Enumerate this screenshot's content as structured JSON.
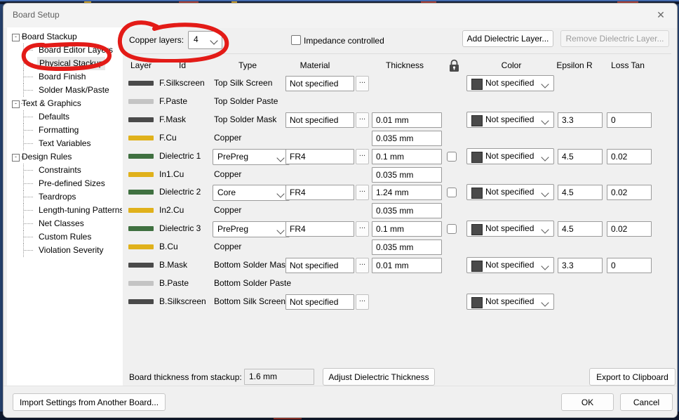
{
  "window": {
    "title": "Board Setup",
    "close_icon": "close-icon"
  },
  "sidebar": {
    "items": [
      {
        "label": "Board Stackup",
        "level": 0,
        "expander": "-"
      },
      {
        "label": "Board Editor Layers",
        "level": 1
      },
      {
        "label": "Physical Stackup",
        "level": 1,
        "selected": true
      },
      {
        "label": "Board Finish",
        "level": 1
      },
      {
        "label": "Solder Mask/Paste",
        "level": 1
      },
      {
        "label": "Text & Graphics",
        "level": 0,
        "expander": "-"
      },
      {
        "label": "Defaults",
        "level": 1
      },
      {
        "label": "Formatting",
        "level": 1
      },
      {
        "label": "Text Variables",
        "level": 1
      },
      {
        "label": "Design Rules",
        "level": 0,
        "expander": "-"
      },
      {
        "label": "Constraints",
        "level": 1
      },
      {
        "label": "Pre-defined Sizes",
        "level": 1
      },
      {
        "label": "Teardrops",
        "level": 1
      },
      {
        "label": "Length-tuning Patterns",
        "level": 1
      },
      {
        "label": "Net Classes",
        "level": 1
      },
      {
        "label": "Custom Rules",
        "level": 1
      },
      {
        "label": "Violation Severity",
        "level": 1
      }
    ]
  },
  "toolbar": {
    "copper_layers_label": "Copper layers:",
    "copper_layers_value": "4",
    "impedance_label": "Impedance controlled",
    "impedance_checked": false,
    "add_dielectric_label": "Add Dielectric Layer...",
    "remove_dielectric_label": "Remove Dielectric Layer...",
    "remove_dielectric_disabled": true
  },
  "table": {
    "headers": {
      "layer": "Layer",
      "id": "Id",
      "type": "Type",
      "material": "Material",
      "thickness": "Thickness",
      "lock": "lock-icon",
      "color": "Color",
      "epsilon": "Epsilon R",
      "loss": "Loss Tan"
    },
    "rows": [
      {
        "swatch": "#4a4a4a",
        "id": "F.Silkscreen",
        "type": "Top Silk Screen",
        "material": "Not specified",
        "has_material": true,
        "thickness": "",
        "has_thickness": false,
        "has_lock": false,
        "color": "Not specified",
        "has_color": true,
        "epsilon": "",
        "loss": ""
      },
      {
        "swatch": "#c4c4c4",
        "id": "F.Paste",
        "type": "Top Solder Paste",
        "material": "",
        "has_material": false,
        "thickness": "",
        "has_thickness": false,
        "has_lock": false,
        "color": "",
        "has_color": false,
        "epsilon": "",
        "loss": ""
      },
      {
        "swatch": "#4a4a4a",
        "id": "F.Mask",
        "type": "Top Solder Mask",
        "material": "Not specified",
        "has_material": true,
        "thickness": "0.01 mm",
        "has_thickness": true,
        "has_lock": false,
        "color": "Not specified",
        "has_color": true,
        "epsilon": "3.3",
        "loss": "0"
      },
      {
        "swatch": "#e0b11b",
        "id": "F.Cu",
        "type": "Copper",
        "material": "",
        "has_material": false,
        "thickness": "0.035 mm",
        "has_thickness": true,
        "has_lock": false,
        "color": "",
        "has_color": false,
        "epsilon": "",
        "loss": ""
      },
      {
        "swatch": "#3f7040",
        "id": "Dielectric 1",
        "type": "PrePreg",
        "type_is_dropdown": true,
        "material": "FR4",
        "has_material": true,
        "thickness": "0.1 mm",
        "has_thickness": true,
        "has_lock": true,
        "color": "Not specified",
        "has_color": true,
        "epsilon": "4.5",
        "loss": "0.02"
      },
      {
        "swatch": "#e0b11b",
        "id": "In1.Cu",
        "type": "Copper",
        "material": "",
        "has_material": false,
        "thickness": "0.035 mm",
        "has_thickness": true,
        "has_lock": false,
        "color": "",
        "has_color": false,
        "epsilon": "",
        "loss": ""
      },
      {
        "swatch": "#3f7040",
        "id": "Dielectric 2",
        "type": "Core",
        "type_is_dropdown": true,
        "material": "FR4",
        "has_material": true,
        "thickness": "1.24 mm",
        "has_thickness": true,
        "has_lock": true,
        "color": "Not specified",
        "has_color": true,
        "epsilon": "4.5",
        "loss": "0.02"
      },
      {
        "swatch": "#e0b11b",
        "id": "In2.Cu",
        "type": "Copper",
        "material": "",
        "has_material": false,
        "thickness": "0.035 mm",
        "has_thickness": true,
        "has_lock": false,
        "color": "",
        "has_color": false,
        "epsilon": "",
        "loss": ""
      },
      {
        "swatch": "#3f7040",
        "id": "Dielectric 3",
        "type": "PrePreg",
        "type_is_dropdown": true,
        "material": "FR4",
        "has_material": true,
        "thickness": "0.1 mm",
        "has_thickness": true,
        "has_lock": true,
        "color": "Not specified",
        "has_color": true,
        "epsilon": "4.5",
        "loss": "0.02"
      },
      {
        "swatch": "#e0b11b",
        "id": "B.Cu",
        "type": "Copper",
        "material": "",
        "has_material": false,
        "thickness": "0.035 mm",
        "has_thickness": true,
        "has_lock": false,
        "color": "",
        "has_color": false,
        "epsilon": "",
        "loss": ""
      },
      {
        "swatch": "#4a4a4a",
        "id": "B.Mask",
        "type": "Bottom Solder Mask",
        "material": "Not specified",
        "has_material": true,
        "thickness": "0.01 mm",
        "has_thickness": true,
        "has_lock": false,
        "color": "Not specified",
        "has_color": true,
        "epsilon": "3.3",
        "loss": "0"
      },
      {
        "swatch": "#c4c4c4",
        "id": "B.Paste",
        "type": "Bottom Solder Paste",
        "material": "",
        "has_material": false,
        "thickness": "",
        "has_thickness": false,
        "has_lock": false,
        "color": "",
        "has_color": false,
        "epsilon": "",
        "loss": ""
      },
      {
        "swatch": "#4a4a4a",
        "id": "B.Silkscreen",
        "type": "Bottom Silk Screen",
        "material": "Not specified",
        "has_material": true,
        "thickness": "",
        "has_thickness": false,
        "has_lock": false,
        "color": "Not specified",
        "has_color": true,
        "epsilon": "",
        "loss": ""
      }
    ]
  },
  "bottom": {
    "board_thickness_label": "Board thickness from stackup:",
    "board_thickness_value": "1.6 mm",
    "adjust_label": "Adjust Dielectric Thickness",
    "export_label": "Export to Clipboard"
  },
  "footer": {
    "import_label": "Import Settings from Another Board...",
    "ok_label": "OK",
    "cancel_label": "Cancel"
  },
  "annotations": {
    "color": "#e31b17",
    "marks": [
      {
        "name": "annotation-circle-physical-stackup",
        "target": "Physical Stackup"
      },
      {
        "name": "annotation-circle-copper-layers",
        "target": "Copper layers: 4"
      }
    ]
  }
}
